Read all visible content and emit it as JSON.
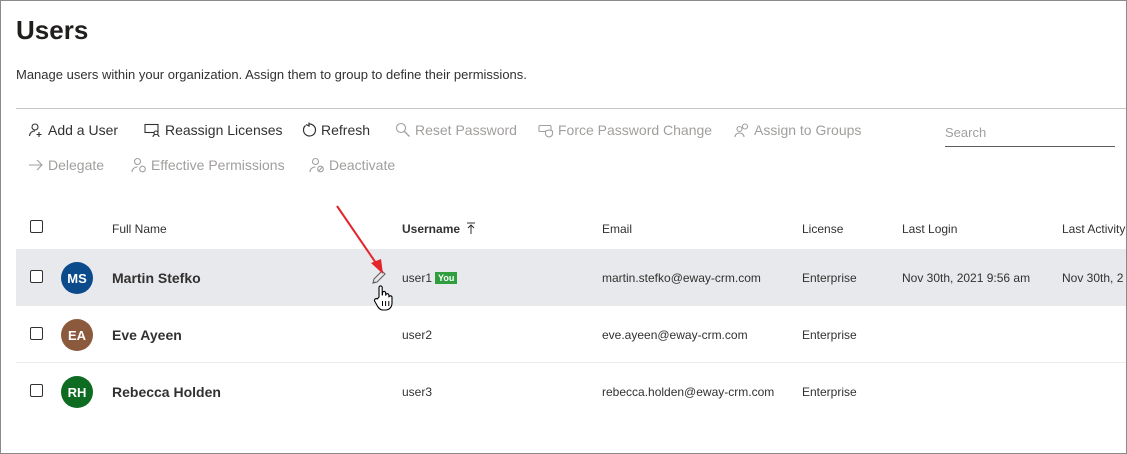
{
  "page": {
    "title": "Users",
    "description": "Manage users within your organization. Assign them to group to define their permissions."
  },
  "toolbar": {
    "add_user": "Add a User",
    "reassign_licenses": "Reassign Licenses",
    "refresh": "Refresh",
    "reset_password": "Reset Password",
    "force_password_change": "Force Password Change",
    "assign_to_groups": "Assign to Groups",
    "delegate": "Delegate",
    "effective_permissions": "Effective Permissions",
    "deactivate": "Deactivate"
  },
  "search": {
    "placeholder": "Search",
    "value": ""
  },
  "table": {
    "columns": {
      "full_name": "Full Name",
      "username": "Username",
      "email": "Email",
      "license": "License",
      "last_login": "Last Login",
      "last_activity": "Last Activity"
    },
    "rows": [
      {
        "initials": "MS",
        "avatar_color": "#0b4a8b",
        "full_name": "Martin Stefko",
        "username": "user1",
        "badge": "You",
        "email": "martin.stefko@eway-crm.com",
        "license": "Enterprise",
        "last_login": "Nov 30th, 2021 9:56 am",
        "last_activity": "Nov 30th, 2"
      },
      {
        "initials": "EA",
        "avatar_color": "#8b5a3c",
        "full_name": "Eve Ayeen",
        "username": "user2",
        "badge": "",
        "email": "eve.ayeen@eway-crm.com",
        "license": "Enterprise",
        "last_login": "",
        "last_activity": ""
      },
      {
        "initials": "RH",
        "avatar_color": "#0e6b22",
        "full_name": "Rebecca Holden",
        "username": "user3",
        "badge": "",
        "email": "rebecca.holden@eway-crm.com",
        "license": "Enterprise",
        "last_login": "",
        "last_activity": ""
      }
    ]
  },
  "colors": {
    "accent_arrow": "#e3242b",
    "badge": "#2e9e3e",
    "selected_row": "#e8e9ec"
  },
  "icons": [
    "person-add-icon",
    "reassign-icon",
    "refresh-icon",
    "key-search-icon",
    "shield-icon",
    "group-icon",
    "arrow-right-icon",
    "person-lock-icon",
    "person-block-icon",
    "sort-up-icon",
    "pencil-icon",
    "hand-cursor-icon"
  ]
}
